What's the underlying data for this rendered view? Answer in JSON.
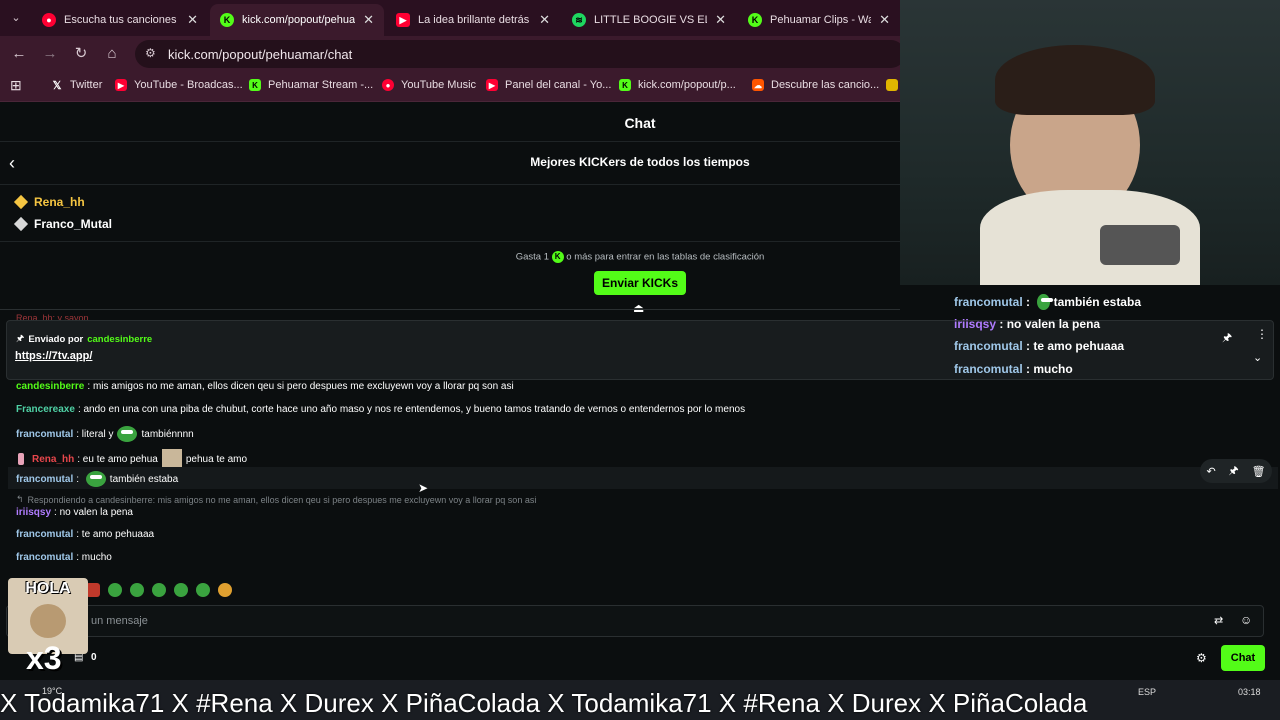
{
  "tabs": [
    {
      "title": "Escucha tus canciones y",
      "icon": "youtube-music-icon",
      "color": "#ff0033"
    },
    {
      "title": "kick.com/popout/pehuar",
      "icon": "kick-icon",
      "color": "#53fc18"
    },
    {
      "title": "La idea brillante detrás d",
      "icon": "youtube-icon",
      "color": "#ff0033"
    },
    {
      "title": "LITTLE BOOGIE VS EL GC",
      "icon": "spotify-icon",
      "color": "#1ed760"
    },
    {
      "title": "Pehuamar Clips - Watch",
      "icon": "kick-icon",
      "color": "#53fc18"
    }
  ],
  "address": {
    "url": "kick.com/popout/pehuamar/chat"
  },
  "bookmarks": [
    {
      "label": "Twitter",
      "icon": "x-icon",
      "color": "#ffffff"
    },
    {
      "label": "YouTube - Broadcas...",
      "icon": "youtube-icon",
      "color": "#ff0033"
    },
    {
      "label": "Pehuamar Stream -...",
      "icon": "kick-icon",
      "color": "#53fc18"
    },
    {
      "label": "YouTube Music",
      "icon": "youtube-music-icon",
      "color": "#ff0033"
    },
    {
      "label": "Panel del canal - Yo...",
      "icon": "youtube-icon",
      "color": "#ff0033"
    },
    {
      "label": "kick.com/popout/p...",
      "icon": "kick-icon",
      "color": "#53fc18"
    },
    {
      "label": "Descubre las cancio...",
      "icon": "soundcloud-icon",
      "color": "#ff5500"
    }
  ],
  "chat": {
    "title": "Chat",
    "leaderboard_title": "Mejores KICKers de todos los tiempos",
    "leaders": [
      {
        "name": "Rena_hh",
        "color": "#f5c542"
      },
      {
        "name": "Franco_Mutal",
        "color": "#ffffff"
      }
    ],
    "kicks_prompt_pre": "Gasta 1",
    "kicks_prompt_post": "o más para entrar en las tablas de clasificación",
    "send_kicks_label": "Enviar KICKs",
    "hidden_row": "Rena_hh: y sayon",
    "pinned_by": "Enviado por",
    "pinned_user": "candesinberre",
    "pinned_link": "https://7tv.app/",
    "messages": [
      {
        "user": "candesinberre",
        "color": "#53fc18",
        "text": "mis amigos no me aman, ellos dicen qeu si pero despues me excluyewn voy a llorar pq son asi"
      },
      {
        "user": "Francereaxe",
        "color": "#4fd1a5",
        "text": "ando en una con una piba de chubut, corte hace uno año maso y nos re entendemos, y bueno tamos tratando de vernos o entendernos por lo menos"
      },
      {
        "user": "francomutal",
        "color": "#9fc7e8",
        "text_pre": "literal y",
        "text_post": "tambiénnnn"
      },
      {
        "user": "Rena_hh",
        "color": "#e8474c",
        "text_pre": "eu te amo pehua",
        "text_post": "pehua te amo"
      },
      {
        "user": "francomutal",
        "color": "#9fc7e8",
        "text_post": "también estaba"
      },
      {
        "reply_to": "Respondiendo a candesinberre: mis amigos no me aman, ellos dicen qeu si pero despues me excluyewn voy a llorar pq son asi"
      },
      {
        "user": "iriisqsy",
        "color": "#b07cff",
        "text": "no valen la pena"
      },
      {
        "user": "francomutal",
        "color": "#9fc7e8",
        "text": "te amo pehuaaa"
      },
      {
        "user": "francomutal",
        "color": "#9fc7e8",
        "text": "mucho"
      }
    ],
    "input_placeholder": "un mensaje",
    "counter": "0",
    "chat_button": "Chat"
  },
  "overlay": {
    "rows": [
      {
        "user": "francomutal",
        "color": "#9fc7e8",
        "text": "también estaba",
        "emote": true
      },
      {
        "user": "iriisqsy",
        "color": "#b07cff",
        "text": "no valen la pena"
      },
      {
        "user": "francomutal",
        "color": "#9fc7e8",
        "text": "te amo pehuaaa"
      },
      {
        "user": "francomutal",
        "color": "#9fc7e8",
        "text": "mucho"
      }
    ]
  },
  "sticker": {
    "top": "HOLA",
    "bottom": "x3"
  },
  "taskbar": {
    "ticker": "X  Todamika71  X    #Rena  X  Durex  X  PiñaColada  X  Todamika71  X    #Rena  X  Durex  X  PiñaColada",
    "weather": "19°C",
    "lang": "ESP",
    "time": "03:18"
  },
  "colors": {
    "accent": "#53fc18",
    "bg": "#0b0e0f"
  }
}
